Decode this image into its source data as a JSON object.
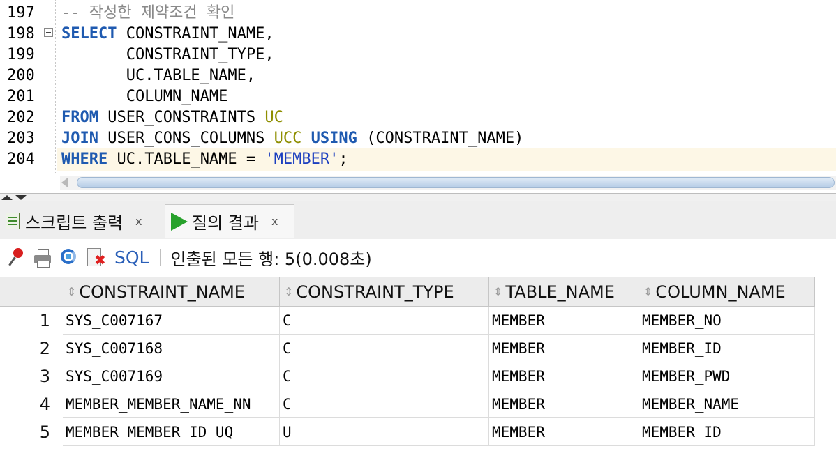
{
  "editor": {
    "line_numbers": [
      "197",
      "198",
      "199",
      "200",
      "201",
      "202",
      "203",
      "204"
    ],
    "comment": "-- 작성한 제약조건 확인",
    "select_kw": "SELECT",
    "col1": "CONSTRAINT_NAME,",
    "col2": "CONSTRAINT_TYPE,",
    "col3": "UC.TABLE_NAME,",
    "col4": "COLUMN_NAME",
    "from_kw": "FROM",
    "from_table": "USER_CONSTRAINTS",
    "alias_uc": "UC",
    "join_kw": "JOIN",
    "join_table": "USER_CONS_COLUMNS",
    "alias_ucc": "UCC",
    "using_kw": "USING",
    "using_clause": "(CONSTRAINT_NAME)",
    "where_kw": "WHERE",
    "where_expr": "UC.TABLE_NAME =",
    "where_value": "'MEMBER'",
    "semicolon": ";"
  },
  "tabs": [
    {
      "label": "스크립트 출력",
      "close": "x",
      "icon": "script-output-icon"
    },
    {
      "label": "질의 결과",
      "close": "x",
      "icon": "run-query-icon"
    }
  ],
  "toolbar": {
    "sql_label": "SQL",
    "status": "인출된 모든 행: 5(0.008초)",
    "icons": [
      "pin-icon",
      "print-icon",
      "refresh-icon",
      "delete-icon"
    ]
  },
  "grid": {
    "columns": [
      "CONSTRAINT_NAME",
      "CONSTRAINT_TYPE",
      "TABLE_NAME",
      "COLUMN_NAME"
    ],
    "sort_glyph": "⇕",
    "rows": [
      {
        "num": "1",
        "cells": [
          "SYS_C007167",
          "C",
          "MEMBER",
          "MEMBER_NO"
        ]
      },
      {
        "num": "2",
        "cells": [
          "SYS_C007168",
          "C",
          "MEMBER",
          "MEMBER_ID"
        ]
      },
      {
        "num": "3",
        "cells": [
          "SYS_C007169",
          "C",
          "MEMBER",
          "MEMBER_PWD"
        ]
      },
      {
        "num": "4",
        "cells": [
          "MEMBER_MEMBER_NAME_NN",
          "C",
          "MEMBER",
          "MEMBER_NAME"
        ]
      },
      {
        "num": "5",
        "cells": [
          "MEMBER_MEMBER_ID_UQ",
          "U",
          "MEMBER",
          "MEMBER_ID"
        ]
      }
    ]
  },
  "colors": {
    "keyword": "#1f5ab0",
    "alias": "#8e8e00",
    "string": "#1c3fbf",
    "comment": "#8a8a8a",
    "current_line": "#fdf7e6"
  }
}
